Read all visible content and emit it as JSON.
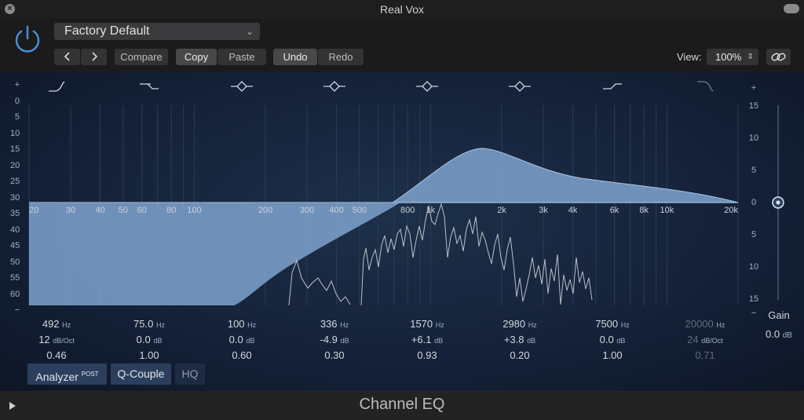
{
  "window": {
    "title": "Real Vox",
    "plugin_name": "Channel EQ"
  },
  "header": {
    "preset": "Factory Default",
    "buttons": {
      "compare": "Compare",
      "copy": "Copy",
      "paste": "Paste",
      "undo": "Undo",
      "redo": "Redo"
    },
    "view_label": "View:",
    "view_zoom": "100%"
  },
  "eq": {
    "left_scale": [
      "+",
      "0",
      "5",
      "10",
      "15",
      "20",
      "25",
      "30",
      "35",
      "40",
      "45",
      "50",
      "55",
      "60",
      "−"
    ],
    "right_scale": [
      "+",
      "15",
      "10",
      "5",
      "0",
      "5",
      "10",
      "15",
      "−"
    ],
    "freq_labels": [
      "20",
      "30",
      "40",
      "50",
      "60",
      "80",
      "100",
      "200",
      "300",
      "400",
      "500",
      "800",
      "1k",
      "2k",
      "3k",
      "4k",
      "6k",
      "8k",
      "10k",
      "20k"
    ],
    "bands": [
      {
        "freq": "492",
        "unit": "Hz",
        "slope_or_gain": "12",
        "slope_unit": "dB/Oct",
        "q": "0.46",
        "dim": false,
        "icon": "low-cut-icon"
      },
      {
        "freq": "75.0",
        "unit": "Hz",
        "slope_or_gain": "0.0",
        "slope_unit": "dB",
        "q": "1.00",
        "dim": false,
        "icon": "low-shelf-icon"
      },
      {
        "freq": "100",
        "unit": "Hz",
        "slope_or_gain": "0.0",
        "slope_unit": "dB",
        "q": "0.60",
        "dim": false,
        "icon": "bell-icon"
      },
      {
        "freq": "336",
        "unit": "Hz",
        "slope_or_gain": "-4.9",
        "slope_unit": "dB",
        "q": "0.30",
        "dim": false,
        "icon": "bell-icon"
      },
      {
        "freq": "1570",
        "unit": "Hz",
        "slope_or_gain": "+6.1",
        "slope_unit": "dB",
        "q": "0.93",
        "dim": false,
        "icon": "bell-icon"
      },
      {
        "freq": "2980",
        "unit": "Hz",
        "slope_or_gain": "+3.8",
        "slope_unit": "dB",
        "q": "0.20",
        "dim": false,
        "icon": "bell-icon"
      },
      {
        "freq": "7500",
        "unit": "Hz",
        "slope_or_gain": "0.0",
        "slope_unit": "dB",
        "q": "1.00",
        "dim": false,
        "icon": "high-shelf-icon"
      },
      {
        "freq": "20000",
        "unit": "Hz",
        "slope_or_gain": "24",
        "slope_unit": "dB/Oct",
        "q": "0.71",
        "dim": true,
        "icon": "high-cut-icon"
      }
    ],
    "gain": {
      "label": "Gain",
      "value": "0.0",
      "unit": "dB"
    },
    "modes": {
      "analyzer": "Analyzer",
      "analyzer_sup": "POST",
      "q_couple": "Q-Couple",
      "hq": "HQ"
    }
  },
  "colors": {
    "accent": "#4a8fd8",
    "curve_fill": "#7fa3cf",
    "background": "#15223a"
  }
}
